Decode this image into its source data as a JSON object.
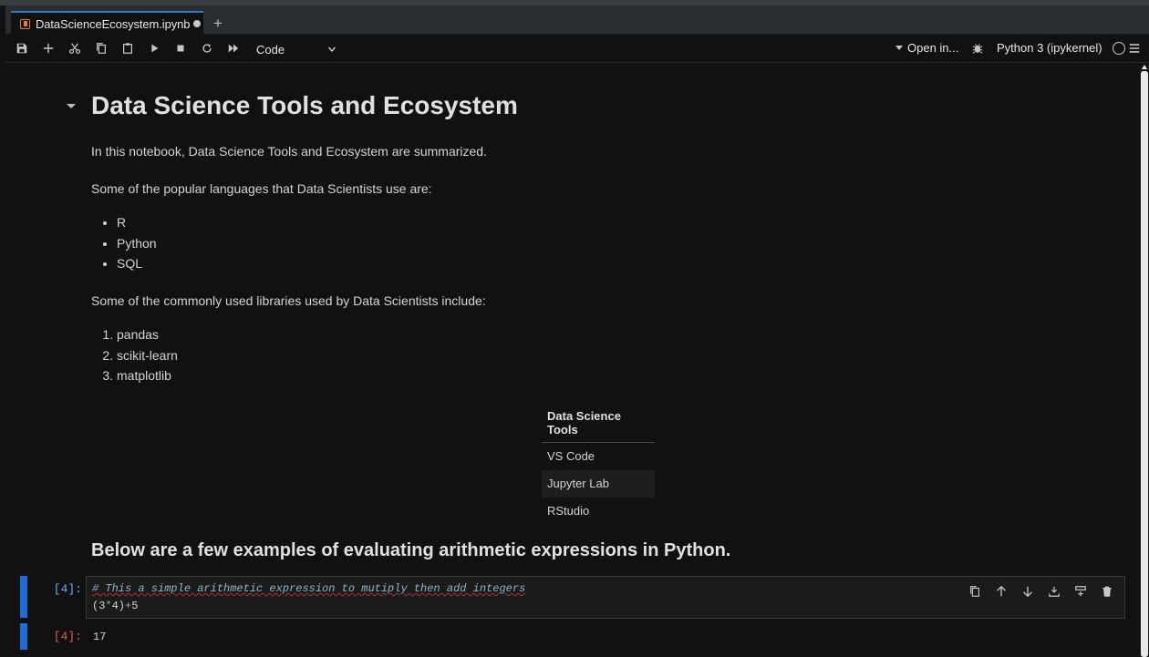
{
  "tab": {
    "title": "DataScienceEcosystem.ipynb",
    "add_label": "+"
  },
  "toolbar": {
    "cell_type": "Code",
    "open_in": "Open in...",
    "kernel": "Python 3 (ipykernel)"
  },
  "notebook": {
    "title": "Data Science Tools and Ecosystem",
    "intro": "In this notebook, Data Science Tools and Ecosystem are summarized.",
    "languages_intro": "Some of the popular languages that Data Scientists use are:",
    "languages": [
      "R",
      "Python",
      "SQL"
    ],
    "libraries_intro": "Some of the commonly used libraries used by Data Scientists include:",
    "libraries": [
      "pandas",
      "scikit-learn",
      "matplotlib"
    ],
    "tools_table": {
      "header": "Data Science Tools",
      "rows": [
        "VS Code",
        "Jupyter Lab",
        "RStudio"
      ]
    },
    "arith_heading": "Below are a few examples of evaluating arithmetic expressions in Python."
  },
  "cell": {
    "in_prompt": "[4]:",
    "out_prompt": "[4]:",
    "code_comment": "# This a simple arithmetic expression to mutiply then add integers",
    "code_line2": {
      "open": "(3",
      "op1": "*",
      "mid": "4)",
      "op2": "+",
      "end": "5"
    },
    "output": "17"
  },
  "colors": {
    "accent": "#1e6cd6",
    "tab_accent": "#2f7dd1",
    "notebook_icon": "#e87c2a"
  }
}
